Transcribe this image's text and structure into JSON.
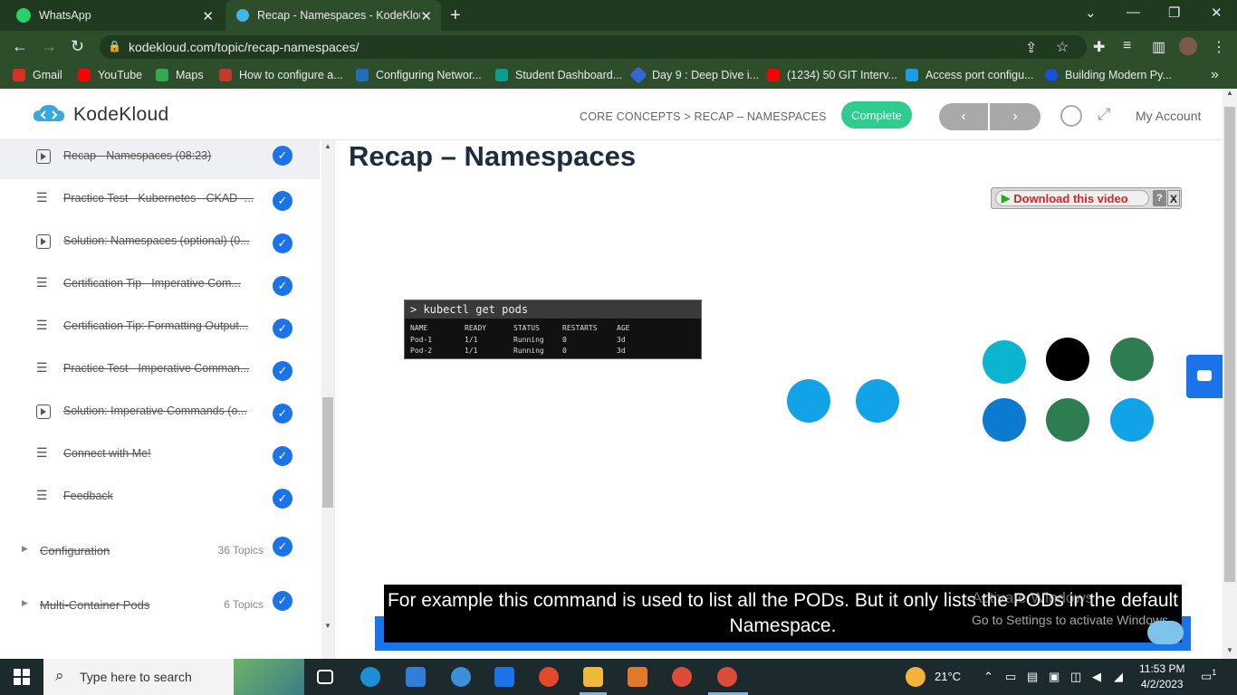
{
  "browser": {
    "tabs": [
      {
        "title": "WhatsApp",
        "close": "✕"
      },
      {
        "title": "Recap - Namespaces - KodeKlou",
        "close": "✕"
      }
    ],
    "new_tab": "+",
    "url": "kodekloud.com/topic/recap-namespaces/",
    "bookmarks": [
      {
        "label": "Gmail",
        "icon": "gmail-icon",
        "color": "#d93025"
      },
      {
        "label": "YouTube",
        "icon": "youtube-icon",
        "color": "#ff0000"
      },
      {
        "label": "Maps",
        "icon": "maps-icon",
        "color": "#34a853"
      },
      {
        "label": "How to configure a...",
        "icon": "page-icon",
        "color": "#c0392b"
      },
      {
        "label": "Configuring Networ...",
        "icon": "vmware-icon",
        "color": "#1d6fb8"
      },
      {
        "label": "Student Dashboard...",
        "icon": "student-icon",
        "color": "#0a9e8f"
      },
      {
        "label": "Day 9 : Deep Dive i...",
        "icon": "diamond-icon",
        "color": "#3367d6"
      },
      {
        "label": "(1234) 50 GIT Interv...",
        "icon": "youtube-icon",
        "color": "#ff0000"
      },
      {
        "label": "Access port configu...",
        "icon": "page-icon",
        "color": "#1a9ee8"
      },
      {
        "label": "Building Modern Py...",
        "icon": "c-icon",
        "color": "#1a4fd8"
      }
    ],
    "more_bookmarks": "»"
  },
  "header": {
    "brand": "KodeKloud",
    "breadcrumb": "CORE CONCEPTS > RECAP – NAMESPACES",
    "complete_label": "Complete",
    "prev_label": "‹",
    "next_label": "›",
    "account_label": "My Account",
    "accent": "#2ecc8e"
  },
  "sidebar": {
    "items": [
      {
        "label": "Recap - Namespaces (08:23)",
        "type": "video",
        "active": true
      },
      {
        "label": "Practice Test - Kubernetes - CKAD -...",
        "type": "doc"
      },
      {
        "label": "Solution: Namespaces (optional) (0...",
        "type": "video"
      },
      {
        "label": "Certification Tip - Imperative Com...",
        "type": "doc"
      },
      {
        "label": "Certification Tip: Formatting Output...",
        "type": "doc"
      },
      {
        "label": "Practice Test - Imperative Comman...",
        "type": "doc"
      },
      {
        "label": "Solution: Imperative Commands (o...",
        "type": "video"
      },
      {
        "label": "Connect with Me!",
        "type": "doc"
      },
      {
        "label": "Feedback",
        "type": "doc"
      }
    ],
    "sections": [
      {
        "label": "Configuration",
        "count": "36 Topics"
      },
      {
        "label": "Multi-Container Pods",
        "count": "6 Topics"
      }
    ],
    "check_mark": "✓"
  },
  "lesson": {
    "title": "Recap – Namespaces",
    "download_label": "Download this video",
    "download_help": "?",
    "download_close": "X",
    "terminal": {
      "command": "> kubectl get pods",
      "headers": [
        "NAME",
        "READY",
        "STATUS",
        "RESTARTS",
        "AGE"
      ],
      "rows": [
        [
          "Pod-1",
          "1/1",
          "Running",
          "0",
          "3d"
        ],
        [
          "Pod-2",
          "1/1",
          "Running",
          "0",
          "3d"
        ]
      ]
    },
    "caption": "For example this command is used to list all the PODs. But it only lists the PODs in the default Namespace.",
    "watermark_title": "Activate Windows",
    "watermark_sub": "Go to Settings to activate Windows.",
    "pod_colors": [
      "#12a2e8",
      "#12a2e8",
      "#0bb5d0",
      "#000000",
      "#2e7d50",
      "#0b7bd0",
      "#2e7d50",
      "#12a2e8"
    ]
  },
  "taskbar": {
    "search_placeholder": "Type here to search",
    "weather": "21°C",
    "time": "11:53 PM",
    "date": "4/2/2023",
    "notification_count": "1"
  }
}
